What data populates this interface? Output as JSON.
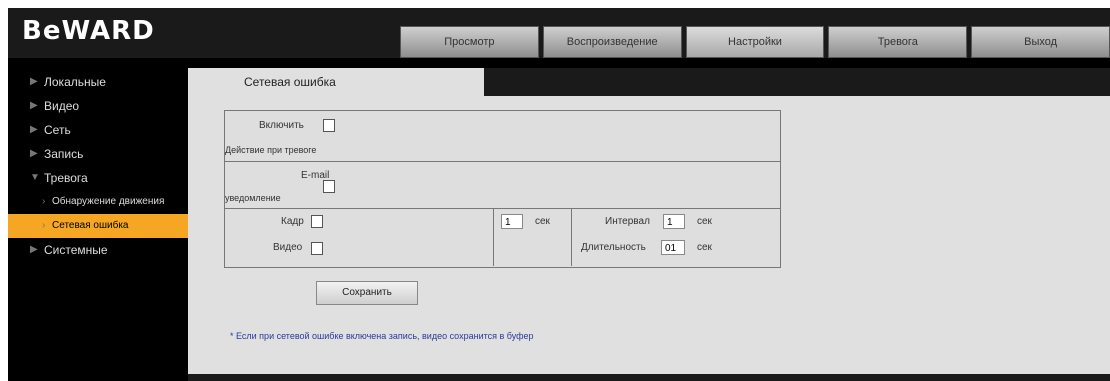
{
  "logo": {
    "text": "BeWARD"
  },
  "topnav": [
    "Просмотр",
    "Воспроизведение",
    "Настройки",
    "Тревога",
    "Выход"
  ],
  "topnav_active": 2,
  "sidebar": {
    "items": [
      {
        "label": "Локальные"
      },
      {
        "label": "Видео"
      },
      {
        "label": "Сеть"
      },
      {
        "label": "Запись"
      },
      {
        "label": "Тревога"
      },
      {
        "label": "Обнаружение движения"
      },
      {
        "label": "Сетевая ошибка"
      },
      {
        "label": "Системные"
      }
    ]
  },
  "subtab": {
    "label": "Сетевая ошибка"
  },
  "settings": {
    "enable_label": "Включить",
    "notify_label": "Действие при тревоге",
    "email_label": "E-mail",
    "email_label2": "уведомление",
    "snapshot_label": "Кадр",
    "snapshot_value": "1",
    "snapshot_unit": "сек",
    "video_label": "Видео",
    "interval_label": "Интервал",
    "interval_value": "1",
    "interval_unit": "сек",
    "duration_label": "Длительность",
    "duration_value": "01",
    "duration_unit": "сек"
  },
  "save_button": "Сохранить",
  "note": "* Если при сетевой ошибке включена запись, видео сохранится в буфер"
}
